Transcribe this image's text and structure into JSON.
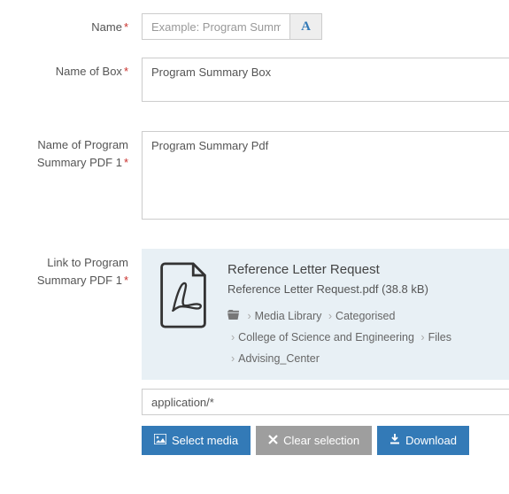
{
  "fields": {
    "name": {
      "label": "Name",
      "placeholder": "Example: Program Summary"
    },
    "box": {
      "label": "Name of Box",
      "value": "Program Summary Box"
    },
    "pdfName": {
      "label": "Name of Program Summary PDF 1",
      "value": "Program Summary Pdf"
    },
    "link": {
      "label": "Link to Program Summary PDF 1"
    }
  },
  "media": {
    "title": "Reference Letter Request",
    "filename": "Reference Letter Request.pdf (38.8 kB)",
    "breadcrumb": [
      "Media Library",
      "Categorised",
      "College of Science and Engineering",
      "Files",
      "Advising_Center"
    ],
    "mime": "application/*"
  },
  "buttons": {
    "select": "Select media",
    "clear": "Clear selection",
    "download": "Download"
  }
}
